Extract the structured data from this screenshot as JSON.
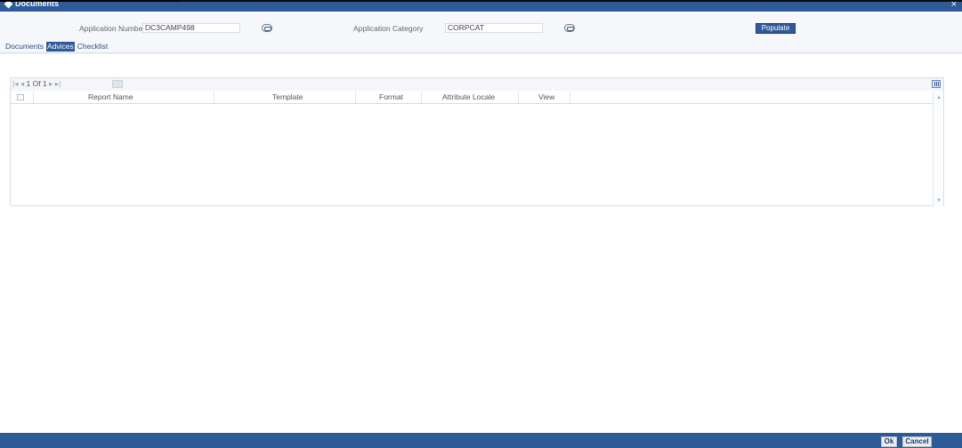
{
  "window": {
    "title": "Documents",
    "close_icon": "close-icon"
  },
  "fields": {
    "application_number": {
      "label": "Application Number",
      "value": "DC3CAMP498"
    },
    "application_category": {
      "label": "Application Category",
      "value": "CORPCAT"
    },
    "populate_label": "Populate"
  },
  "tabs": [
    {
      "label": "Documents",
      "active": false
    },
    {
      "label": "Advices",
      "active": true
    },
    {
      "label": "Checklist",
      "active": false
    }
  ],
  "grid": {
    "pager": {
      "prefix": "|◂ ◂",
      "current": "1",
      "of": "Of",
      "total": "1",
      "suffix": "▸ ▸|"
    },
    "columns": [
      "Report Name",
      "Template",
      "Format",
      "Attribute Locale",
      "View"
    ]
  },
  "footer": {
    "ok_label": "Ok",
    "cancel_label": "Cancel"
  },
  "colors": {
    "brand": "#2f5a98",
    "background": "#ffffff",
    "header": "#f5f7fa"
  }
}
